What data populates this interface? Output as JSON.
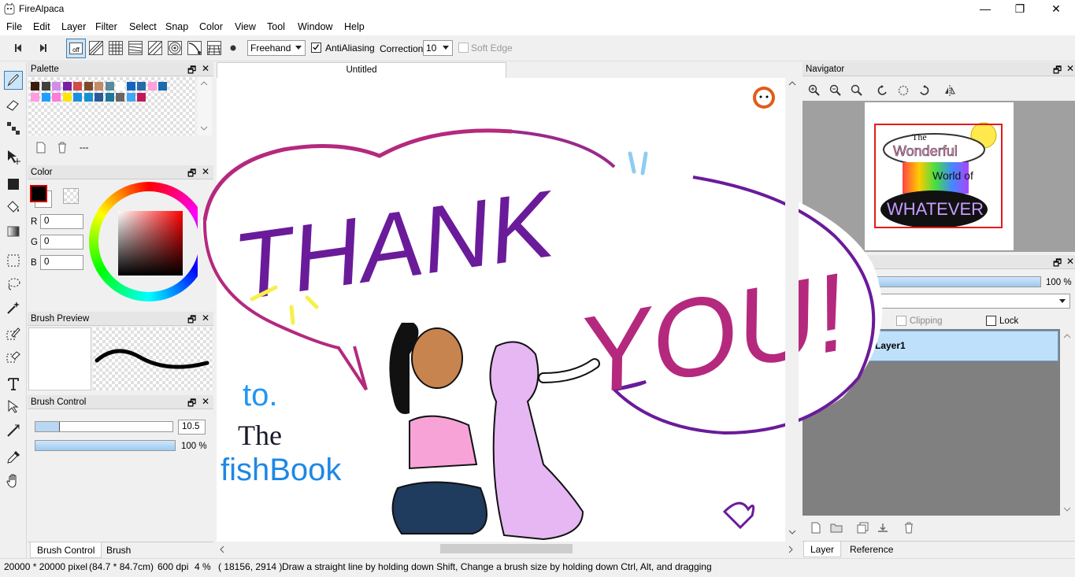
{
  "window": {
    "title": "FireAlpaca",
    "minimize": "—",
    "maximize": "❐",
    "close": "✕"
  },
  "menu": [
    "File",
    "Edit",
    "Layer",
    "Filter",
    "Select",
    "Snap",
    "Color",
    "View",
    "Tool",
    "Window",
    "Help"
  ],
  "toolbar": {
    "off_label": "off",
    "mode": "Freehand",
    "antialiasing_label": "AntiAliasing",
    "antialiasing_checked": true,
    "correction_label": "Correction",
    "correction_value": "10",
    "soft_edge_label": "Soft Edge",
    "soft_edge_checked": false
  },
  "palette": {
    "title": "Palette",
    "float_icon": "🗗",
    "close_icon": "✕",
    "colors_row1": [
      "#3b1d0e",
      "#404040",
      "#d18ee8",
      "#7b1fa2",
      "#d24a4a",
      "#7a4a2a",
      "#c48a6a",
      "#5a8aa0",
      "#ffffff",
      "#1565c0",
      "#2a6aa8",
      "#ffa0dc",
      "#1a6ab0"
    ],
    "colors_row2": [
      "#ff9de0",
      "#1ea0ff",
      "#ff7ad9",
      "#ffe600",
      "#1a90e0",
      "#1690d0",
      "#2a5a9a",
      "#1a7a9a",
      "#666666",
      "#42a5f5",
      "#c2185b"
    ],
    "footer_text": "---"
  },
  "color_panel": {
    "title": "Color",
    "r_label": "R",
    "r_value": "0",
    "g_label": "G",
    "g_value": "0",
    "b_label": "B",
    "b_value": "0",
    "primary": "#000000"
  },
  "brush_preview": {
    "title": "Brush Preview"
  },
  "brush_control": {
    "title": "Brush Control",
    "size_value": "10.5",
    "size_fraction": 0.18,
    "opacity_value": "100 %",
    "opacity_fraction": 1.0
  },
  "left_tabs": [
    "Brush Control",
    "Brush"
  ],
  "canvas": {
    "tab_title": "Untitled",
    "art_text_thank": "THANK",
    "art_text_you": "YOU!",
    "art_text_to": "to.",
    "art_text_the": "The",
    "art_text_fishbook": "fishBook"
  },
  "navigator": {
    "title": "Navigator",
    "thumb_text_the": "The",
    "thumb_text_wonderful": "Wonderful",
    "thumb_text_world": "World of",
    "thumb_text_whatever": "WHATEVER"
  },
  "layer_panel": {
    "opacity_value": "100 %",
    "opacity_fraction": 1.0,
    "clipping_label": "Clipping",
    "lock_label": "Lock",
    "layer_name": "Layer1"
  },
  "right_tabs": [
    "Layer",
    "Reference"
  ],
  "status": {
    "size": "20000 * 20000 pixel",
    "physical": "(84.7 * 84.7cm)",
    "dpi": "600 dpi",
    "zoom": "4 %",
    "coords": "( 18156, 2914 )",
    "hint": "Draw a straight line by holding down Shift, Change a brush size by holding down Ctrl, Alt, and dragging"
  }
}
